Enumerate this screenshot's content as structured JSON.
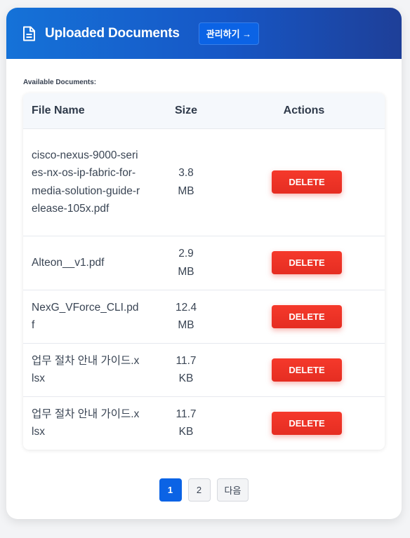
{
  "header": {
    "title": "Uploaded Documents",
    "manage_label": "관리하기 →",
    "icon": "document-icon"
  },
  "available_label": "Available Documents:",
  "table": {
    "columns": [
      "File Name",
      "Size",
      "Actions"
    ],
    "rows": [
      {
        "name": "cisco-nexus-9000-series-nx-os-ip-fabric-for-media-solution-guide-release-105x.pdf",
        "size": "3.8 MB",
        "action": "DELETE"
      },
      {
        "name": "Alteon__v1.pdf",
        "size": "2.9 MB",
        "action": "DELETE"
      },
      {
        "name": "NexG_VForce_CLI.pdf",
        "size": "12.4 MB",
        "action": "DELETE"
      },
      {
        "name": "업무 절차 안내 가이드.xlsx",
        "size": "11.7 KB",
        "action": "DELETE"
      },
      {
        "name": "업무 절차 안내 가이드.xlsx",
        "size": "11.7 KB",
        "action": "DELETE"
      }
    ]
  },
  "pagination": {
    "pages": [
      "1",
      "2"
    ],
    "current": "1",
    "next_label": "다음"
  },
  "colors": {
    "header_gradient_start": "#1572d8",
    "header_gradient_end": "#1e3f98",
    "primary": "#0b63e5",
    "danger": "#f5392b"
  }
}
